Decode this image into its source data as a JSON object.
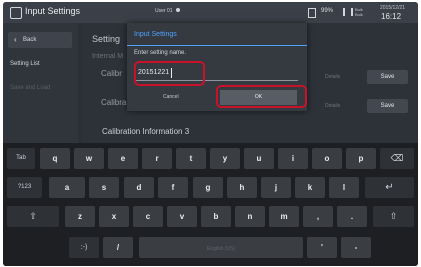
{
  "status_bar": {
    "title": "Input Settings",
    "user_label": "User 01",
    "battery_text": "99%",
    "bulk_label": "Bulk Bulk",
    "date": "2015/12/21",
    "time": "16:12"
  },
  "sidebar": {
    "back_label": "Back",
    "items": [
      "Setting List",
      "Save and Load"
    ]
  },
  "main": {
    "title": "Setting",
    "subtitle": "Internal M",
    "rows": [
      {
        "label": "Calibr",
        "details": "Details",
        "save": "Save"
      },
      {
        "label": "Calibra",
        "details": "Details",
        "save": "Save"
      },
      {
        "label": "Calibration Information 3",
        "details": "",
        "save": ""
      }
    ]
  },
  "dialog": {
    "title": "Input Settings",
    "label": "Enter setting name.",
    "input_value": "20151221",
    "cancel_label": "Cancel",
    "ok_label": "OK"
  },
  "keyboard": {
    "row1": [
      "Tab",
      "q",
      "w",
      "e",
      "r",
      "t",
      "y",
      "u",
      "i",
      "o",
      "p",
      "⌫"
    ],
    "row2": [
      "?123",
      "a",
      "s",
      "d",
      "f",
      "g",
      "h",
      "j",
      "k",
      "l",
      "↵"
    ],
    "row3": [
      "⇧",
      "z",
      "x",
      "c",
      "v",
      "b",
      "n",
      "m",
      ",",
      ".",
      "⇧"
    ],
    "row4": [
      ":-)",
      "/",
      "English (US)",
      "'",
      "-"
    ]
  },
  "colors": {
    "accent": "#4da3ff",
    "highlight": "#c9122a"
  }
}
